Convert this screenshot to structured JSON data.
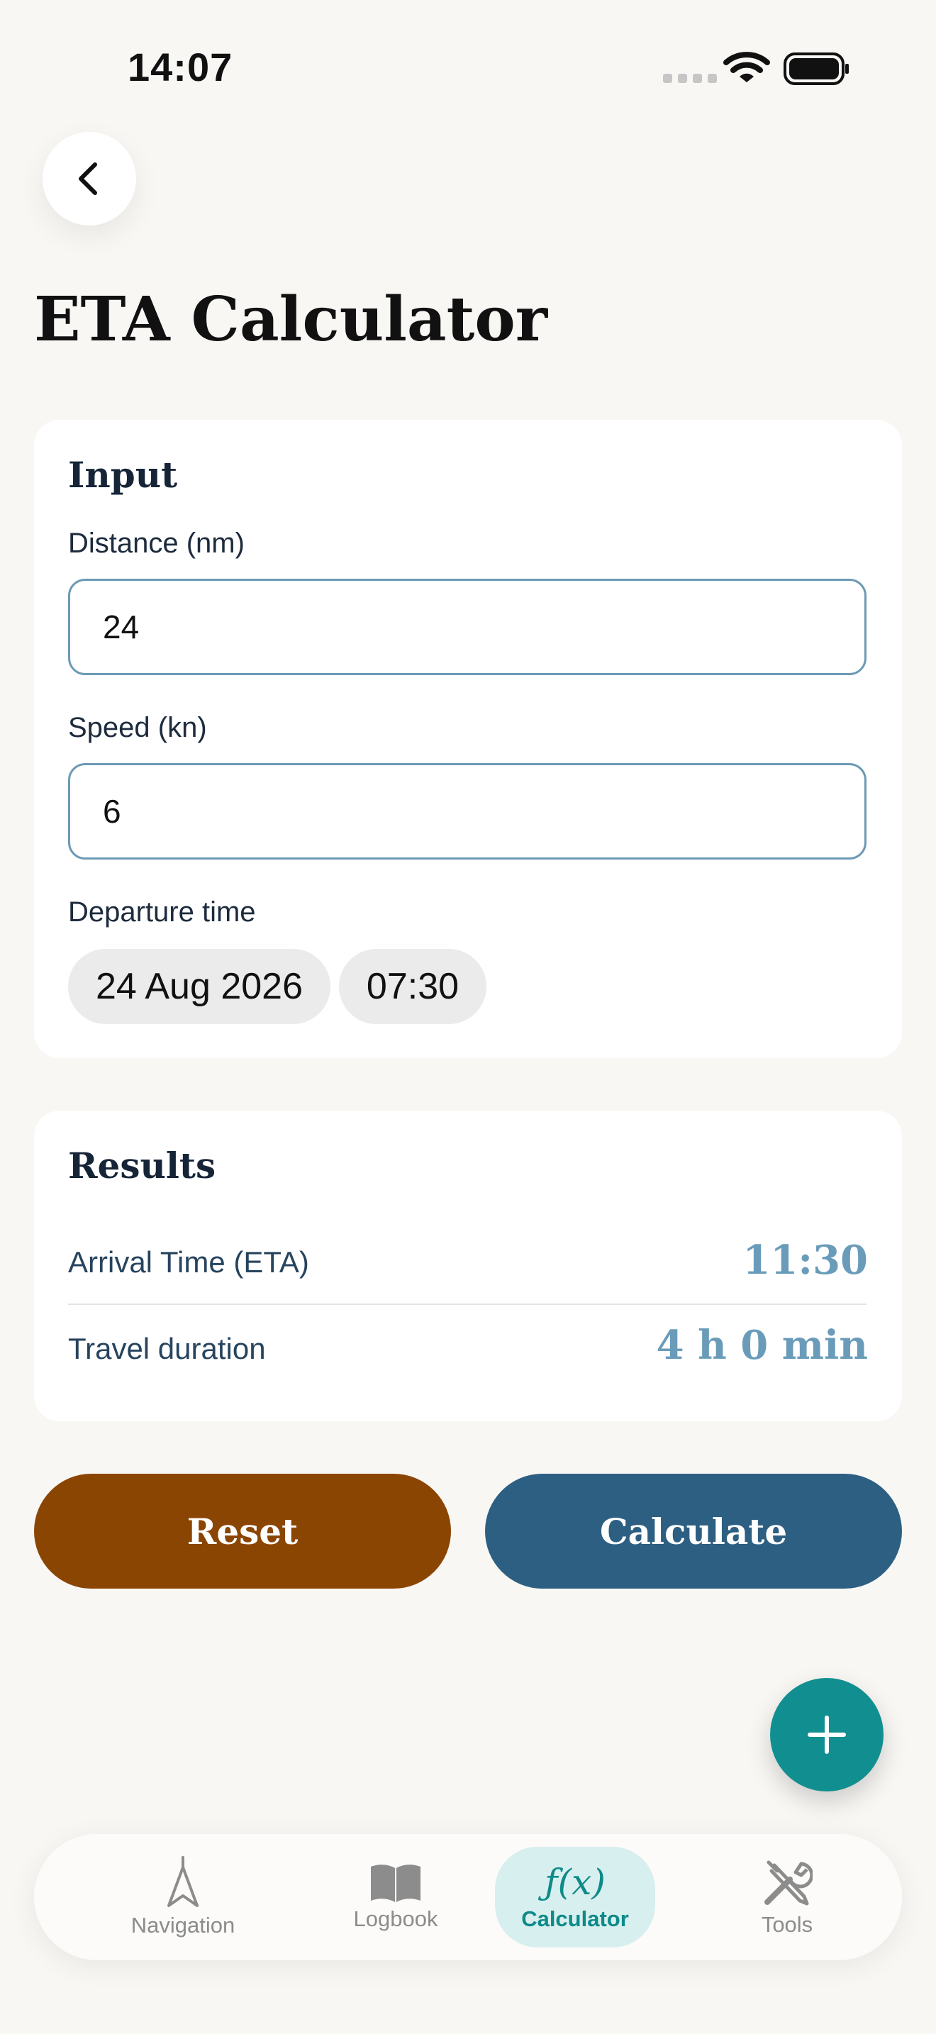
{
  "status_bar": {
    "time": "14:07"
  },
  "header": {
    "title": "ETA Calculator",
    "back_icon": "chevron-left-icon"
  },
  "input_card": {
    "heading": "Input",
    "distance": {
      "label": "Distance (nm)",
      "value": "24"
    },
    "speed": {
      "label": "Speed (kn)",
      "value": "6"
    },
    "departure": {
      "label": "Departure time",
      "date": "24 Aug 2026",
      "time": "07:30"
    }
  },
  "results_card": {
    "heading": "Results",
    "rows": [
      {
        "label": "Arrival Time (ETA)",
        "value": "11:30"
      },
      {
        "label": "Travel duration",
        "value": "4 h 0 min"
      }
    ]
  },
  "actions": {
    "reset_label": "Reset",
    "calculate_label": "Calculate"
  },
  "fab": {
    "icon": "plus-icon"
  },
  "tab_bar": {
    "active": "Calculator",
    "items": [
      {
        "label": "Navigation",
        "icon": "compass-arrow-icon"
      },
      {
        "label": "Logbook",
        "icon": "book-icon"
      },
      {
        "label": "Calculator",
        "icon": "function-icon",
        "glyph": "ƒ(x)"
      },
      {
        "label": "Tools",
        "icon": "tools-icon"
      }
    ]
  },
  "colors": {
    "accent_teal": "#118f90",
    "reset": "#8b4503",
    "calculate": "#2d5f82",
    "result_value": "#6a9cba"
  }
}
